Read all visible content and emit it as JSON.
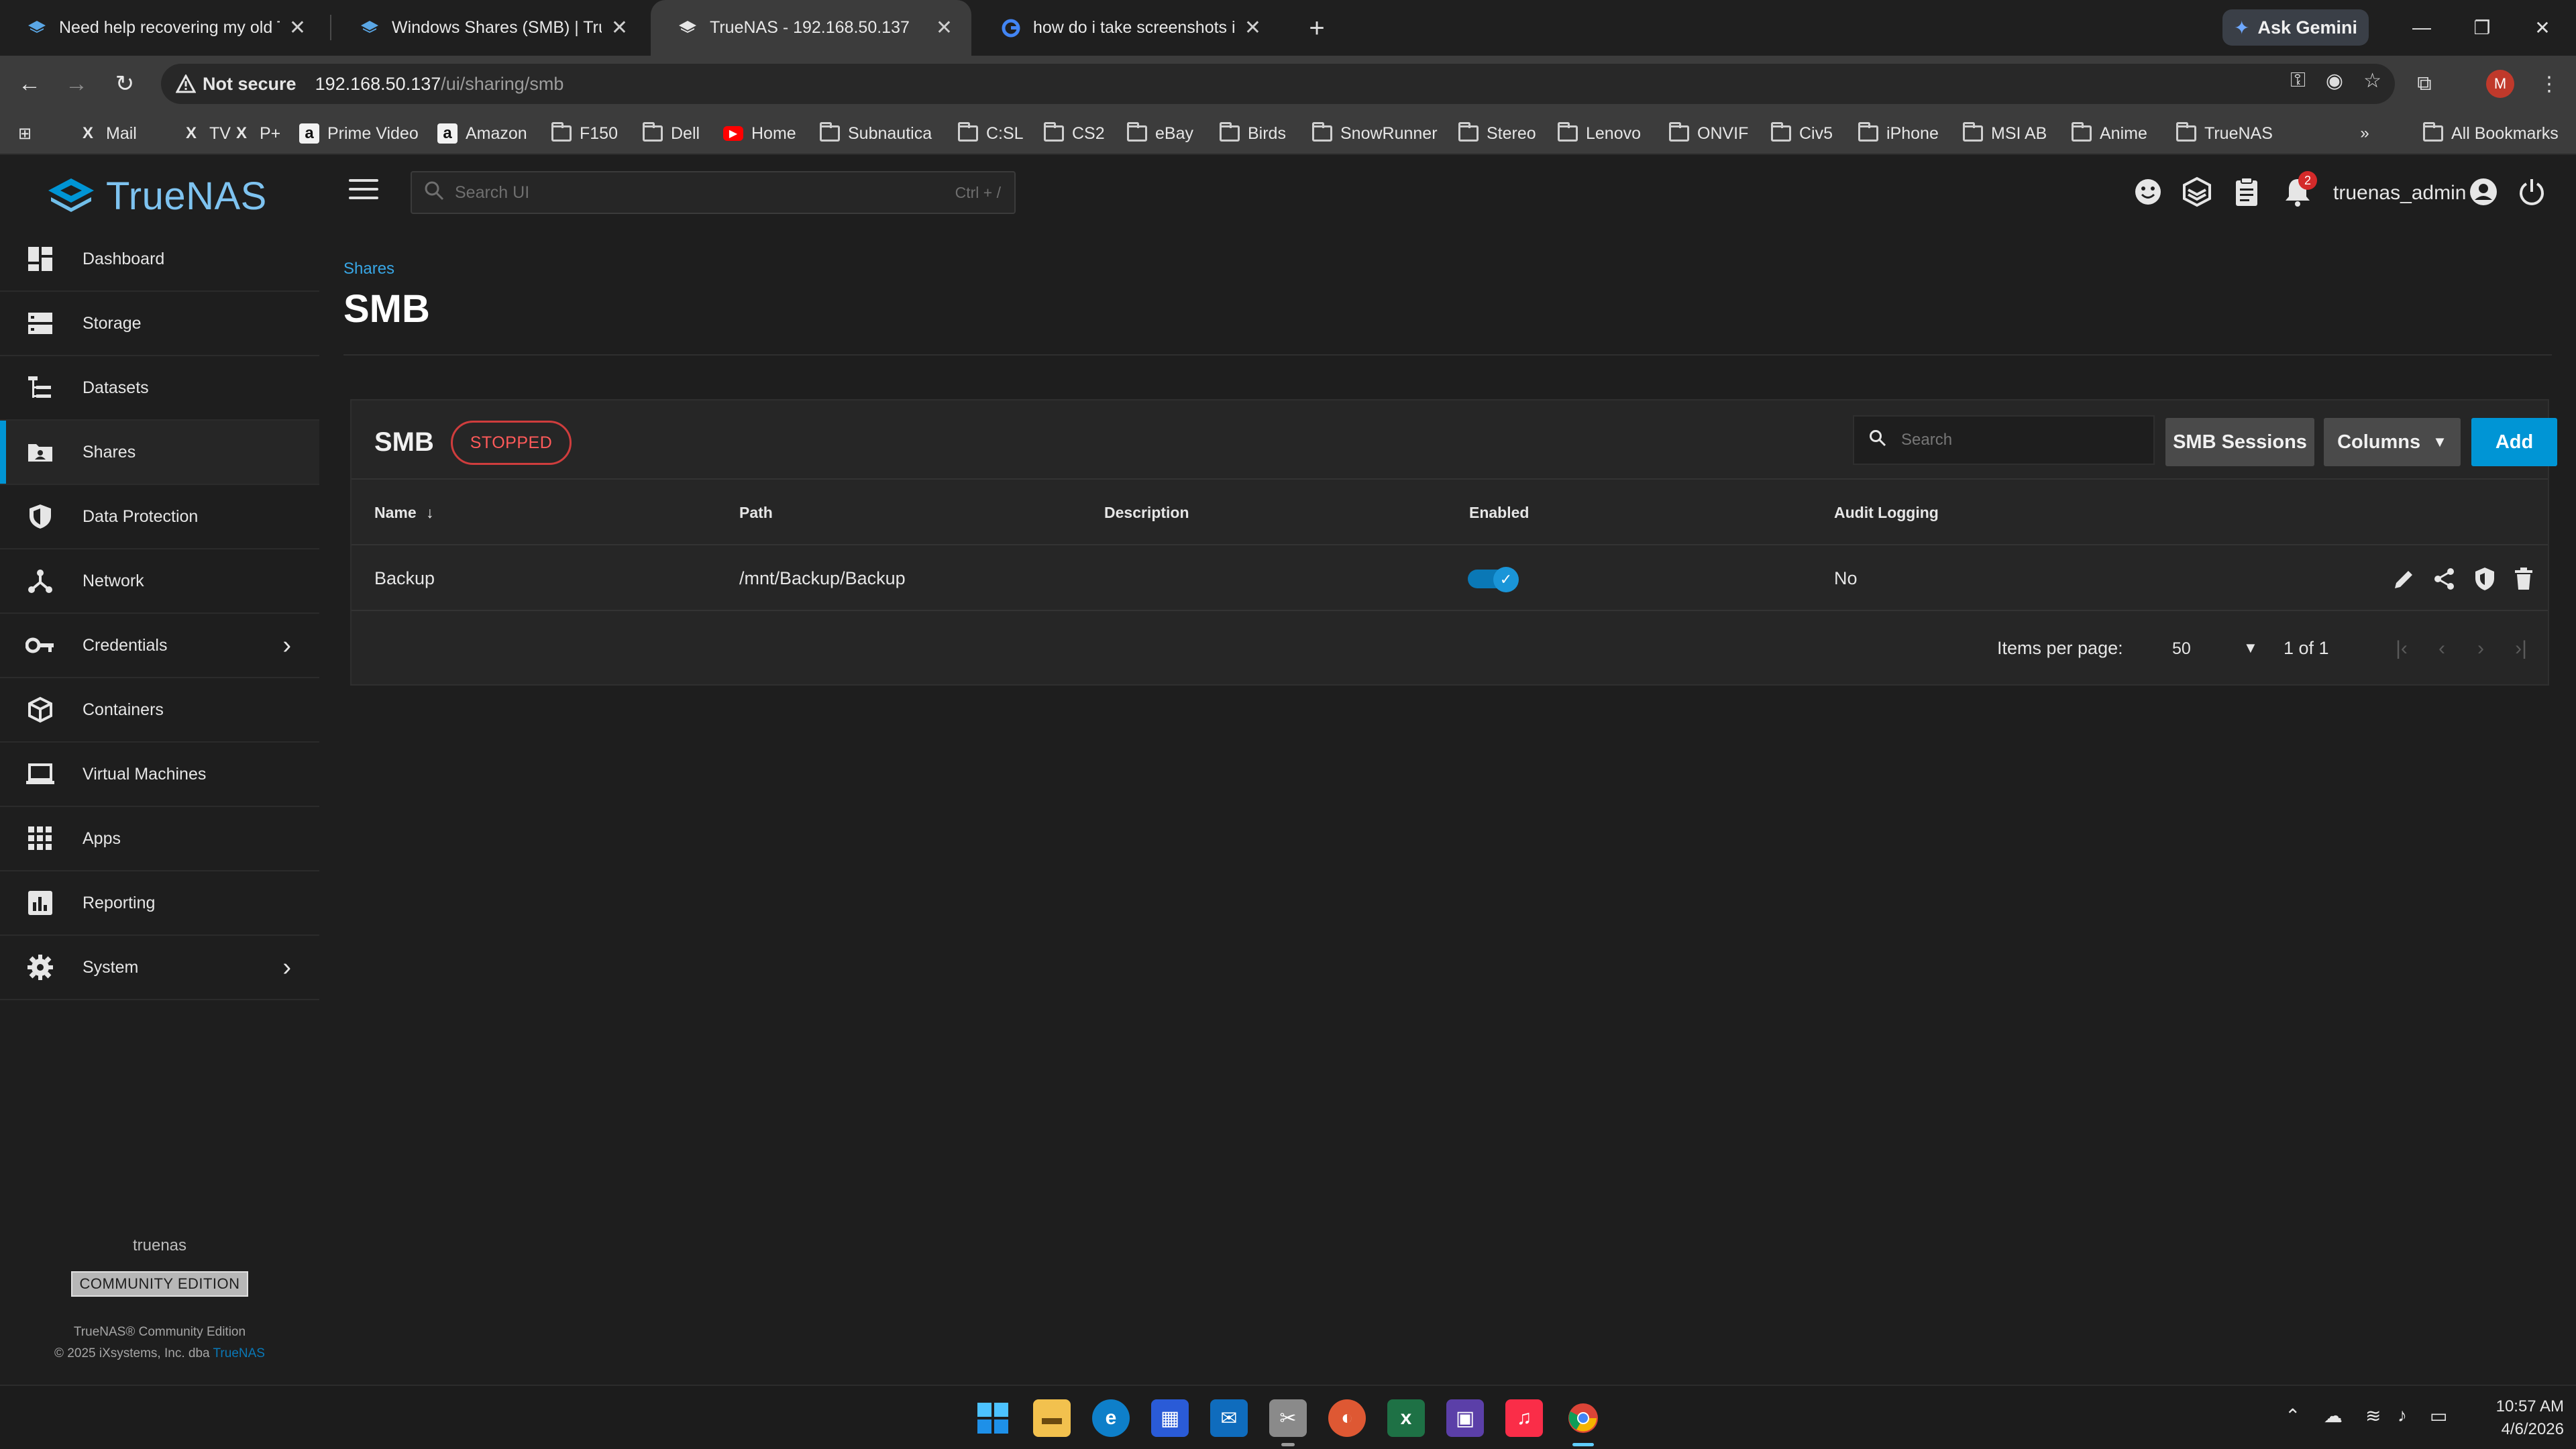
{
  "browser": {
    "tabs": [
      {
        "title": "Need help recovering my old TrueNAS",
        "icon": "truenas-favicon"
      },
      {
        "title": "Windows Shares (SMB) | TrueNAS",
        "icon": "truenas-favicon"
      },
      {
        "title": "TrueNAS - 192.168.50.137",
        "icon": "truenas-favicon"
      },
      {
        "title": "how do i take screenshots in truenas",
        "icon": "google-favicon"
      }
    ],
    "gemini_label": "Ask Gemini",
    "not_secure": "Not secure",
    "url_host": "192.168.50.137",
    "url_path": "/ui/sharing/smb",
    "profile_initial": "M",
    "bookmarks": [
      {
        "label": "Mail",
        "icon": "x-icon"
      },
      {
        "label": "TV",
        "icon": "x-icon"
      },
      {
        "label": "P+",
        "icon": "x-icon"
      },
      {
        "label": "Prime Video",
        "icon": "amazon-icon"
      },
      {
        "label": "Amazon",
        "icon": "amazon-icon"
      },
      {
        "label": "F150",
        "icon": "folder-icon"
      },
      {
        "label": "Dell",
        "icon": "folder-icon"
      },
      {
        "label": "Home",
        "icon": "youtube-icon"
      },
      {
        "label": "Subnautica",
        "icon": "folder-icon"
      },
      {
        "label": "C:SL",
        "icon": "folder-icon"
      },
      {
        "label": "CS2",
        "icon": "folder-icon"
      },
      {
        "label": "eBay",
        "icon": "folder-icon"
      },
      {
        "label": "Birds",
        "icon": "folder-icon"
      },
      {
        "label": "SnowRunner",
        "icon": "folder-icon"
      },
      {
        "label": "Stereo",
        "icon": "folder-icon"
      },
      {
        "label": "Lenovo",
        "icon": "folder-icon"
      },
      {
        "label": "ONVIF",
        "icon": "folder-icon"
      },
      {
        "label": "Civ5",
        "icon": "folder-icon"
      },
      {
        "label": "iPhone",
        "icon": "folder-icon"
      },
      {
        "label": "MSI AB",
        "icon": "folder-icon"
      },
      {
        "label": "Anime",
        "icon": "folder-icon"
      },
      {
        "label": "TrueNAS",
        "icon": "folder-icon"
      }
    ],
    "all_bookmarks": "All Bookmarks"
  },
  "app": {
    "logo_text": "TrueNAS",
    "search_placeholder": "Search UI",
    "search_hint": "Ctrl + /",
    "notification_count": "2",
    "username": "truenas_admin",
    "accent": "#0095d5"
  },
  "sidebar": {
    "items": [
      {
        "label": "Dashboard",
        "icon": "dashboard-icon"
      },
      {
        "label": "Storage",
        "icon": "storage-icon"
      },
      {
        "label": "Datasets",
        "icon": "datasets-icon"
      },
      {
        "label": "Shares",
        "icon": "shares-icon",
        "active": true
      },
      {
        "label": "Data Protection",
        "icon": "shield-icon"
      },
      {
        "label": "Network",
        "icon": "network-icon"
      },
      {
        "label": "Credentials",
        "icon": "key-icon",
        "expandable": true
      },
      {
        "label": "Containers",
        "icon": "cube-icon"
      },
      {
        "label": "Virtual Machines",
        "icon": "laptop-icon"
      },
      {
        "label": "Apps",
        "icon": "apps-grid-icon"
      },
      {
        "label": "Reporting",
        "icon": "chart-icon"
      },
      {
        "label": "System",
        "icon": "gear-icon",
        "expandable": true
      }
    ],
    "hostname": "truenas",
    "edition": "COMMUNITY EDITION",
    "copyright_line1": "TrueNAS® Community Edition",
    "copyright_line2_prefix": "© 2025 iXsystems, Inc. dba ",
    "copyright_brand": "TrueNAS"
  },
  "page": {
    "breadcrumb": "Shares",
    "title": "SMB",
    "card": {
      "title": "SMB",
      "status": "STOPPED",
      "search_placeholder": "Search",
      "sessions_label": "SMB Sessions",
      "columns_label": "Columns",
      "add_label": "Add",
      "columns": [
        "Name",
        "Path",
        "Description",
        "Enabled",
        "Audit Logging"
      ],
      "sort_indicator": "↓",
      "rows": [
        {
          "name": "Backup",
          "path": "/mnt/Backup/Backup",
          "description": "",
          "enabled": true,
          "audit_logging": "No"
        }
      ],
      "items_per_page_label": "Items per page:",
      "items_per_page": "50",
      "range": "1 of 1"
    }
  },
  "taskbar": {
    "time": "10:57 AM",
    "date": "4/6/2026"
  }
}
